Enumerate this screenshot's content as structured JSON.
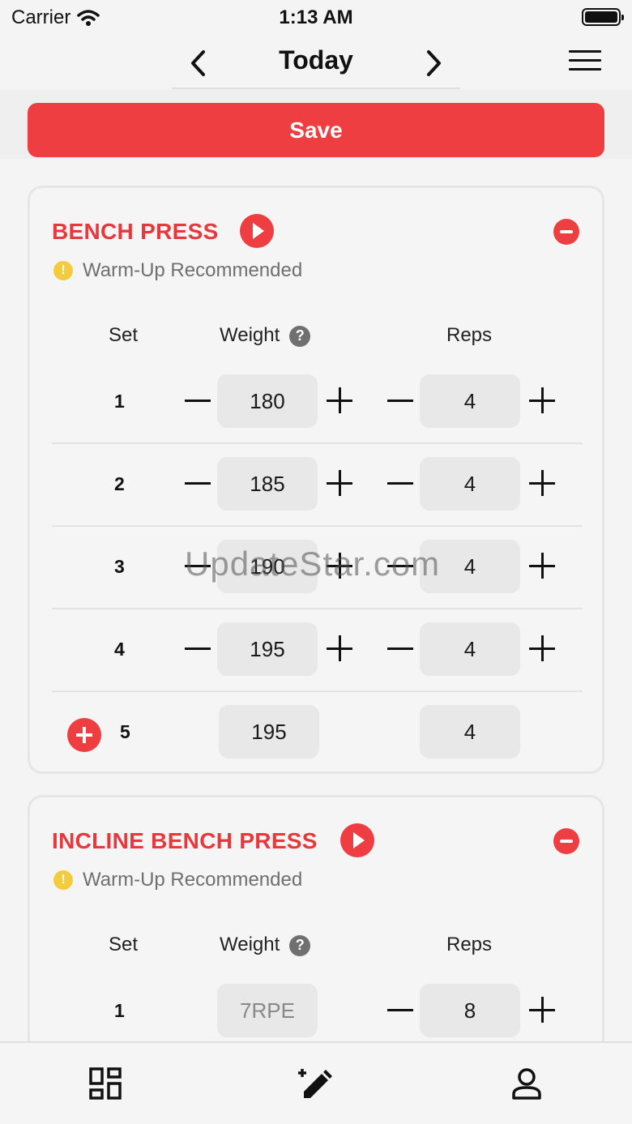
{
  "status_bar": {
    "carrier": "Carrier",
    "time": "1:13 AM"
  },
  "nav": {
    "title": "Today"
  },
  "save_label": "Save",
  "exercises": [
    {
      "name": "BENCH PRESS",
      "warning": "Warm-Up Recommended",
      "headers": {
        "set": "Set",
        "weight": "Weight",
        "reps": "Reps"
      },
      "sets": [
        {
          "set": "1",
          "weight": "180",
          "reps": "4"
        },
        {
          "set": "2",
          "weight": "185",
          "reps": "4"
        },
        {
          "set": "3",
          "weight": "190",
          "reps": "4"
        },
        {
          "set": "4",
          "weight": "195",
          "reps": "4"
        },
        {
          "set": "5",
          "weight": "195",
          "reps": "4"
        }
      ]
    },
    {
      "name": "INCLINE BENCH PRESS",
      "warning": "Warm-Up Recommended",
      "headers": {
        "set": "Set",
        "weight": "Weight",
        "reps": "Reps"
      },
      "sets": [
        {
          "set": "1",
          "weight_placeholder": "7RPE",
          "reps": "8"
        }
      ]
    }
  ],
  "help_glyph": "?",
  "warn_glyph": "!",
  "watermark": "UpdateStar.com",
  "tabs": [
    {
      "icon": "dashboard-icon"
    },
    {
      "icon": "edit-icon"
    },
    {
      "icon": "profile-icon"
    }
  ],
  "colors": {
    "accent": "#ef3e42",
    "warning": "#f2cc3c",
    "background": "#f4f4f4"
  }
}
